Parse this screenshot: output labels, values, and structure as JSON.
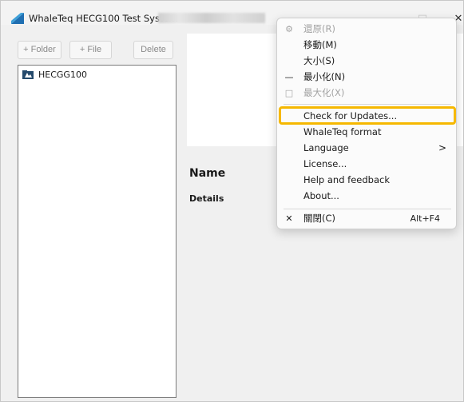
{
  "window": {
    "title": "WhaleTeq HECG100 Test System",
    "controls": {
      "minimize": "—",
      "maximize": "□",
      "close": "✕"
    }
  },
  "toolbar": {
    "folder_label": "+ Folder",
    "file_label": "+ File",
    "delete_label": "Delete"
  },
  "tree": {
    "items": [
      {
        "label": "HECGG100",
        "icon": "folder-icon"
      }
    ]
  },
  "details": {
    "name_label": "Name",
    "details_label": "Details"
  },
  "context_menu": {
    "items": [
      {
        "label": "還原(R)",
        "icon": "restore-icon",
        "enabled": false
      },
      {
        "label": "移動(M)",
        "enabled": true
      },
      {
        "label": "大小(S)",
        "enabled": true
      },
      {
        "label": "最小化(N)",
        "icon": "minimize-icon",
        "enabled": true
      },
      {
        "label": "最大化(X)",
        "icon": "maximize-icon",
        "enabled": false
      },
      {
        "label": "Check for Updates...",
        "enabled": true,
        "highlighted": true
      },
      {
        "label": "WhaleTeq format",
        "enabled": true
      },
      {
        "label": "Language",
        "enabled": true,
        "submenu": true,
        "submenu_glyph": ">"
      },
      {
        "label": "License...",
        "enabled": true
      },
      {
        "label": "Help and feedback",
        "enabled": true
      },
      {
        "label": "About...",
        "enabled": true
      },
      {
        "label": "關閉(C)",
        "icon": "close-icon",
        "enabled": true,
        "shortcut": "Alt+F4"
      }
    ]
  },
  "colors": {
    "highlight_border": "#f6b800",
    "disabled_text": "#a3a3a3",
    "app_icon": "#1f6fb2"
  }
}
